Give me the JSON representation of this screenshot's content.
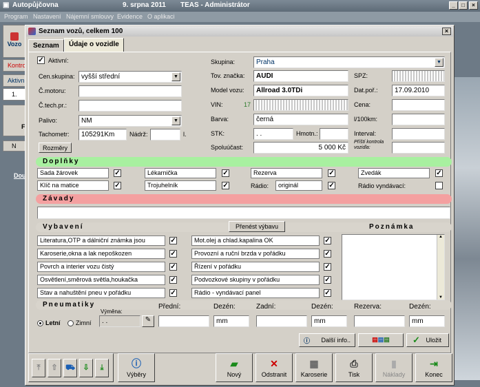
{
  "app": {
    "title_left": "Autopůjčovna",
    "title_date": "9. srpna 2011",
    "title_right": "TEAS - Administrátor",
    "btn_min": "_",
    "btn_max": "□",
    "btn_close": "×",
    "menu": [
      "Program",
      "Nastavení",
      "Nájemní smlouvy",
      "Evidence",
      "O aplikaci"
    ],
    "side": {
      "vozo": "Vozo",
      "kontrol": "Kontro",
      "aktivn": "Aktivn",
      "one": "1.",
      "f": "F",
      "n": "N",
      "dou": "Dou"
    }
  },
  "window": {
    "title": "Seznam vozů, celkem 100",
    "close": "×",
    "tabs": [
      "Seznam",
      "Údaje o vozidle"
    ]
  },
  "form": {
    "aktivni_label": "Aktivní:",
    "aktivni_check": "✓",
    "cen_skupina_label": "Cen.skupina:",
    "cen_skupina_value": "vyšší střední",
    "c_motoru_label": "Č.motoru:",
    "c_motoru_value": "",
    "c_tech_label": "Č.tech.pr.:",
    "c_tech_value": "",
    "palivo_label": "Palivo:",
    "palivo_value": "NM",
    "tachometr_label": "Tachometr:",
    "tachometr_value": "105291Km",
    "nadrz_label": "Nádrž:",
    "nadrz_value": "",
    "nadrz_unit": "l.",
    "rozmery_button": "Rozměry",
    "skupina_label": "Skupina:",
    "skupina_value": "Praha",
    "tov_znacka_label": "Tov. značka:",
    "tov_znacka_value": "AUDI",
    "model_label": "Model vozu:",
    "model_value": "Allroad 3.0TDi",
    "vin_label": "VIN:",
    "vin_count": "17",
    "vin_value": "",
    "barva_label": "Barva:",
    "barva_value": "černá",
    "stk_label": "STK:",
    "stk_value": "  .  .",
    "hmotn_label": "Hmotn.:",
    "hmotn_value": "",
    "spoluucast_label": "Spoluúčast:",
    "spoluucast_value": "5 000 Kč",
    "spz_label": "SPZ:",
    "spz_value": "",
    "dat_por_label": "Dat.poř.:",
    "dat_por_value": "17.09.2010",
    "cena_label": "Cena:",
    "cena_value": "",
    "l100_label": "l/100km:",
    "l100_value": "",
    "interval_label": "Interval:",
    "interval_value": "",
    "pristi_label": "Příští kontrola vozidla:",
    "pristi_value": ""
  },
  "doplnky": {
    "title": "Doplňky",
    "check": "✓",
    "items": [
      {
        "label": "Sada žárovek",
        "checked": true
      },
      {
        "label": "Lékarnička",
        "checked": true
      },
      {
        "label": "Rezerva",
        "checked": true
      },
      {
        "label": "Zvedák",
        "checked": true
      },
      {
        "label": "Klíč na matice",
        "checked": true
      },
      {
        "label": "Trojuhelník",
        "checked": true
      }
    ],
    "radio_label": "Rádio:",
    "radio_value": "originál",
    "radio_vyndavaci": "Rádio vyndávací:"
  },
  "zavady": {
    "title": "Závady",
    "value": ""
  },
  "vybaveni": {
    "title": "Vybavení",
    "prenest_button": "Přenést výbavu",
    "poznamka_title": "Poznámka",
    "check": "✓",
    "left": [
      "Literatura,OTP a dálniční známka jsou",
      "Karoserie,okna a lak nepoškozen",
      "Povrch a interier vozu čistý",
      "Osvětlení,směrová světla,houkačka",
      "Stav a nahuštění pneu v pořádku"
    ],
    "right": [
      "Mot.olej a chlad.kapalina OK",
      "Provozní a ruční brzda v pořádku",
      "Řízení v pořádku",
      "Podvozkové skupiny v pořádku",
      "Rádio - vyndávací panel"
    ],
    "scroll_up": "▲",
    "scroll_down": "▼"
  },
  "pneu": {
    "title": "Pneumatiky",
    "letni": "Letní",
    "zimni": "Zimní",
    "vymena_label": "Výměna:",
    "vymena_value": "  .  .",
    "predni": "Přední:",
    "dezen": "Dezén:",
    "zadni": "Zadní:",
    "rezerva": "Rezerva:",
    "mm": "mm"
  },
  "actions": {
    "dalsi_info": "Další info..",
    "ulozit": "Uložit"
  },
  "toolbar": {
    "vybery": "Výběry",
    "novy": "Nový",
    "odstranit": "Odstranit",
    "karoserie": "Karoserie",
    "tisk": "Tisk",
    "naklady": "Náklady",
    "konec": "Konec"
  },
  "colors": {
    "doplnky_bar": "#a8f0a0",
    "zavady_bar": "#f4a0a0",
    "vybaveni_bar": "#d8d4cc"
  }
}
